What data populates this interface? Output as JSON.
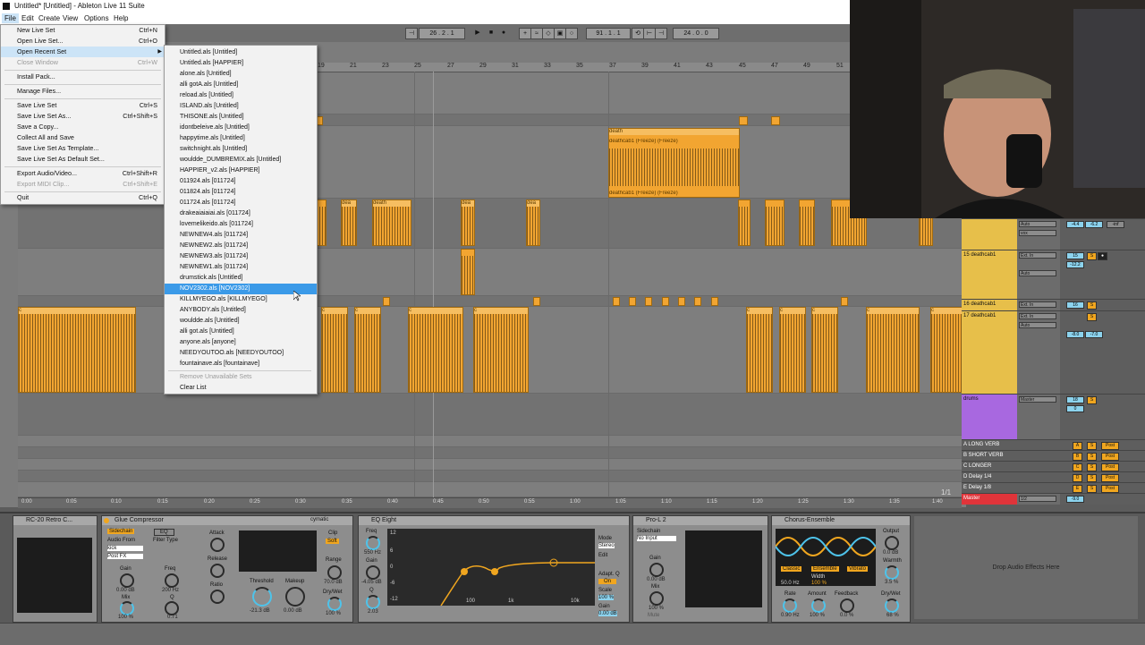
{
  "window": {
    "title": "Untitled* [Untitled] - Ableton Live 11 Suite"
  },
  "menubar": [
    "File",
    "Edit",
    "Create",
    "View",
    "Options",
    "Help"
  ],
  "transport": {
    "tempo": "26 . 2 . 1",
    "position": "91 . 1 . 1",
    "loop_length": "24 . 0 . 0"
  },
  "file_menu": [
    {
      "label": "New Live Set",
      "shortcut": "Ctrl+N"
    },
    {
      "label": "Open Live Set...",
      "shortcut": "Ctrl+O"
    },
    {
      "label": "Open Recent Set",
      "shortcut": "",
      "highlighted": true
    },
    {
      "label": "Close Window",
      "shortcut": "Ctrl+W",
      "disabled": true
    },
    {
      "label": "Install Pack...",
      "shortcut": ""
    },
    {
      "label": "Manage Files...",
      "shortcut": ""
    },
    {
      "label": "Save Live Set",
      "shortcut": "Ctrl+S"
    },
    {
      "label": "Save Live Set As...",
      "shortcut": "Ctrl+Shift+S"
    },
    {
      "label": "Save a Copy...",
      "shortcut": ""
    },
    {
      "label": "Collect All and Save",
      "shortcut": ""
    },
    {
      "label": "Save Live Set As Template...",
      "shortcut": ""
    },
    {
      "label": "Save Live Set As Default Set...",
      "shortcut": ""
    },
    {
      "label": "Export Audio/Video...",
      "shortcut": "Ctrl+Shift+R"
    },
    {
      "label": "Export MIDI Clip...",
      "shortcut": "Ctrl+Shift+E",
      "disabled": true
    },
    {
      "label": "Quit",
      "shortcut": "Ctrl+Q"
    }
  ],
  "recent_sets": [
    "Untitled.als [Untitled]",
    "Untitled.als [HAPPIER]",
    "alone.als [Untitled]",
    "alli gotA.als [Untitled]",
    "reload.als [Untitled]",
    "ISLAND.als [Untitled]",
    "THISONE.als [Untitled]",
    "idontbeleive.als [Untitled]",
    "happytime.als [Untitled]",
    "switchnight.als [Untitled]",
    "wouldde_DUMBREMIX.als [Untitled]",
    "HAPPIER_v2.als [HAPPIER]",
    "011924.als [011724]",
    "011824.als [011724]",
    "011724.als [011724]",
    "drakeaiaiaiai.als [011724]",
    "lovemelikeido.als [011724]",
    "NEWNEW4.als [011724]",
    "NEWNEW2.als [011724]",
    "NEWNEW3.als [011724]",
    "NEWNEW1.als [011724]",
    "drumstick.als [Untitled]",
    "NOV2302.als [NOV2302]",
    "KILLMYEGO.als [KILLMYEGO]",
    "ANYBODY.als [Untitled]",
    "wouldde.als [Untitled]",
    "alli got.als [Untitled]",
    "anyone.als [anyone]",
    "NEEDYOUTOO.als [NEEDYOUTOO]",
    "fountainave.als [fountainave]"
  ],
  "recent_highlighted_index": 22,
  "recent_footer": [
    "Remove Unavailable Sets",
    "Clear List"
  ],
  "ruler_labels": [
    "19",
    "21",
    "23",
    "25",
    "27",
    "29",
    "31",
    "33",
    "35",
    "37",
    "39",
    "41",
    "43",
    "45",
    "47",
    "49",
    "51"
  ],
  "clip_names": {
    "death": "death",
    "freeze_top": "deathcab1 (Freeze) (Freeze)",
    "freeze_bottom": "deathcab1 (Freeze) (Freeze)",
    "c_clip": "c",
    "d_clip": "d",
    "dea": "dea"
  },
  "timebar_labels": [
    "0:00",
    "0:05",
    "0:10",
    "0:15",
    "0:20",
    "0:25",
    "0:30",
    "0:35",
    "0:40",
    "0:45",
    "0:50",
    "0:55",
    "1:00",
    "1:05",
    "1:10",
    "1:15",
    "1:20",
    "1:25",
    "1:30",
    "1:35",
    "1:40"
  ],
  "zoom_label": "1/1",
  "mixer": {
    "tracks": [
      {
        "name": "",
        "input": "vox",
        "vol": "-4.4",
        "pan": "-6.2",
        "color": "#e7bf4a"
      },
      {
        "name": "15 deathcab1",
        "input": "Ext. In",
        "vol": "15",
        "pan": "-12.2",
        "color": "#e7bf4a"
      },
      {
        "name": "16 deathcab1",
        "input": "Ext. In",
        "vol": "16",
        "pan": "",
        "color": "#e7bf4a"
      },
      {
        "name": "17 deathcab1",
        "input": "Ext. In",
        "vol": "-8.0",
        "pan": "-7.0",
        "color": "#e7bf4a"
      },
      {
        "name": "drums",
        "input": "Master",
        "vol": "18",
        "pan": "0",
        "color": "#a868e0"
      },
      {
        "name": "A LONG VERB",
        "input": "",
        "vol": "A",
        "pan": "",
        "color": "#2d8fd8"
      },
      {
        "name": "B SHORT VERB",
        "input": "",
        "vol": "B",
        "pan": "",
        "color": "#2d8fd8"
      },
      {
        "name": "C LONGER",
        "input": "",
        "vol": "C",
        "pan": "",
        "color": "#2d8fd8"
      },
      {
        "name": "D Delay 1/4",
        "input": "",
        "vol": "D",
        "pan": "",
        "color": "#e07a2d"
      },
      {
        "name": "E Delay 1/8",
        "input": "",
        "vol": "E",
        "pan": "",
        "color": "#e07a2d"
      },
      {
        "name": "Master",
        "input": "1/2",
        "vol": "-9.0",
        "pan": "",
        "color": "#e0343a"
      }
    ],
    "labels": {
      "auto": "Auto",
      "off": "Off",
      "post": "Post",
      "s": "S",
      "inf": "-inf"
    }
  },
  "devices": {
    "rc20": {
      "title": "RC-20 Retro C..."
    },
    "glue": {
      "title": "Glue Compressor",
      "brand": "cymatic",
      "sidechain": "Sidechain",
      "eq": "EQ",
      "audio_from": "Audio From",
      "source": "kick",
      "post_fx": "Post FX",
      "filter_type": "Filter Type",
      "gain": "Gain",
      "gain_val": "0.00 dB",
      "freq": "Freq",
      "freq_val": "200 Hz",
      "mix": "Mix",
      "mix_val": "100 %",
      "q": "Q",
      "q_val": "0.71",
      "attack": "Attack",
      "release": "Release",
      "ratio": "Ratio",
      "threshold": "Threshold",
      "threshold_val": "-21.3 dB",
      "makeup": "Makeup",
      "makeup_val": "0.00 dB",
      "clip": "Clip",
      "soft": "Soft",
      "range": "Range",
      "range_val": "70.0 dB",
      "drywet": "Dry/Wet",
      "drywet_val": "100 %"
    },
    "eq": {
      "title": "EQ Eight",
      "freq": "Freq",
      "freq_val": "550 Hz",
      "gain": "Gain",
      "gain_val": "-4.05 dB",
      "q": "Q",
      "q_val": "2.03",
      "mode": "Mode",
      "mode_val": "Stereo",
      "edit": "Edit",
      "adapt_q": "Adapt. Q",
      "on": "On",
      "scale": "Scale",
      "scale_val": "100 %",
      "out_gain": "Gain",
      "out_gain_val": "0.00 dB",
      "y_labels": [
        "12",
        "6",
        "0",
        "-6",
        "-12"
      ],
      "x_labels": [
        "100",
        "1k",
        "10k"
      ]
    },
    "pro_l2": {
      "title": "Pro-L 2",
      "sidechain": "Sidechain",
      "input": "No Input",
      "gain": "Gain",
      "gain_val": "0.00 dB",
      "mix": "Mix",
      "mix_val": "100 %",
      "mute": "Mute"
    },
    "chorus": {
      "title": "Chorus-Ensemble",
      "classic": "Classic",
      "ensemble": "Ensemble",
      "vibrato": "Vibrato",
      "width": "Width",
      "width_val": "100 %",
      "freq_val": "50.0 Hz",
      "output": "Output",
      "output_val": "0.0 dB",
      "warmth": "Warmth",
      "warmth_val": "3.5 %",
      "rate": "Rate",
      "rate_val": "0.90 Hz",
      "amount": "Amount",
      "amount_val": "100 %",
      "feedback": "Feedback",
      "feedback_val": "0.0 %",
      "drywet": "Dry/Wet",
      "drywet_val": "68 %"
    },
    "drop_hint": "Drop Audio Effects Here"
  },
  "colors": {
    "clip": "#f2a531",
    "selection": "#3b9ae8",
    "accent_cyan": "#4ec3ea"
  }
}
